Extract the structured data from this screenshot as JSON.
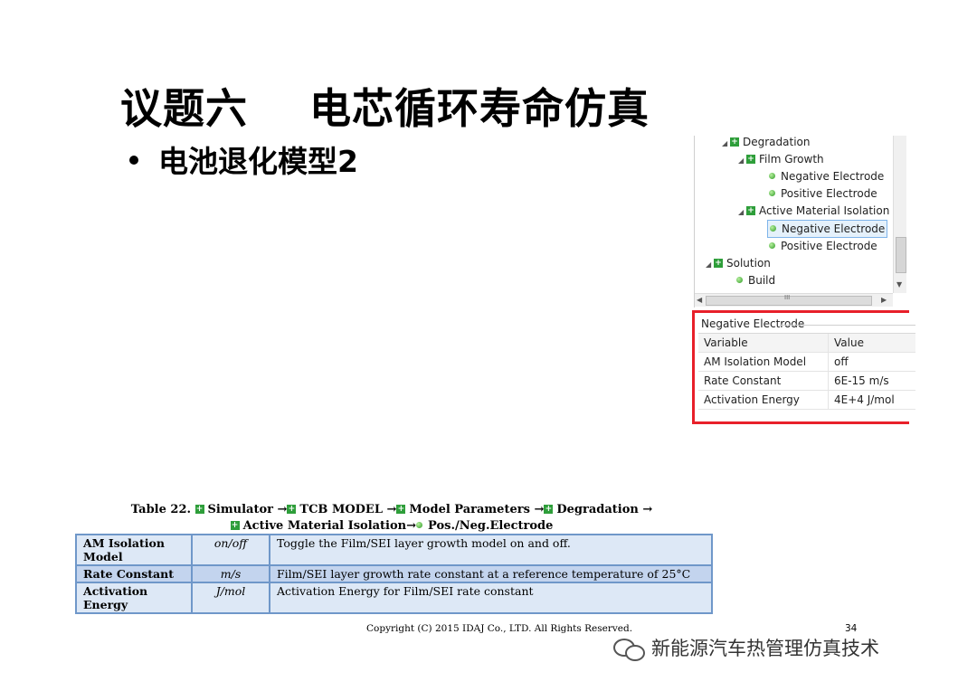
{
  "slide": {
    "title": "议题六    电芯循环寿命仿真",
    "bullet": "电池退化模型2"
  },
  "tree": {
    "items": [
      {
        "label": "Degradation",
        "icon": "plus-square-icon"
      },
      {
        "label": "Film Growth",
        "icon": "plus-square-icon"
      },
      {
        "label": "Negative Electrode",
        "icon": "green-dot-icon"
      },
      {
        "label": "Positive Electrode",
        "icon": "green-dot-icon"
      },
      {
        "label": "Active Material Isolation",
        "icon": "plus-square-icon"
      },
      {
        "label": "Negative Electrode",
        "icon": "green-dot-icon",
        "selected": true
      },
      {
        "label": "Positive Electrode",
        "icon": "green-dot-icon"
      },
      {
        "label": "Solution",
        "icon": "plus-square-icon"
      },
      {
        "label": "Build",
        "icon": "green-dot-icon"
      }
    ],
    "hscroll_glyph": "III"
  },
  "props": {
    "header": "Negative Electrode",
    "col_variable": "Variable",
    "col_value": "Value",
    "rows": [
      {
        "variable": "AM Isolation Model",
        "value": "off"
      },
      {
        "variable": "Rate Constant",
        "value": "6E-15 m/s"
      },
      {
        "variable": "Activation Energy",
        "value": "4E+4 J/mol"
      }
    ]
  },
  "caption": {
    "prefix": "Table 22.",
    "p1": "Simulator",
    "p2": "TCB MODEL",
    "p3": "Model Parameters",
    "p4": "Degradation",
    "p5": "Active Material Isolation",
    "p6": "Pos./Neg.Electrode"
  },
  "table": {
    "rows": [
      {
        "name": "AM Isolation Model",
        "unit": "on/off",
        "desc": "Toggle the Film/SEI layer growth model on and off."
      },
      {
        "name": "Rate Constant",
        "unit": "m/s",
        "desc": "Film/SEI layer growth rate constant at a reference temperature of 25°C"
      },
      {
        "name": "Activation Energy",
        "unit": "J/mol",
        "desc": "Activation Energy for Film/SEI rate constant"
      }
    ]
  },
  "footer": {
    "copyright": "Copyright (C) 2015 IDAJ Co., LTD. All Rights Reserved.",
    "page": "34",
    "watermark": "新能源汽车热管理仿真技术"
  },
  "colors": {
    "highlight_border": "#e8202a",
    "table_border": "#6f97c9",
    "icon_green": "#2e9e3a"
  }
}
